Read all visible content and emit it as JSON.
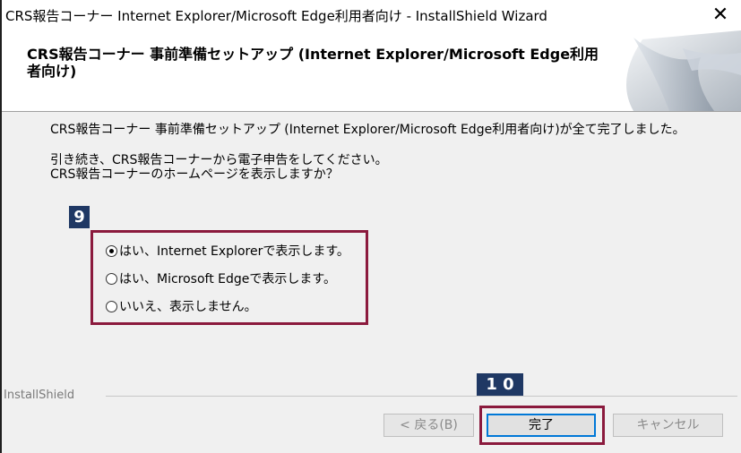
{
  "window": {
    "title": "CRS報告コーナー Internet Explorer/Microsoft Edge利用者向け - InstallShield Wizard",
    "close_glyph": "✕"
  },
  "header": {
    "title": "CRS報告コーナー 事前準備セットアップ (Internet Explorer/Microsoft Edge利用者向け)"
  },
  "body": {
    "complete_message": "CRS報告コーナー 事前準備セットアップ (Internet Explorer/Microsoft Edge利用者向け)が全て完了しました。",
    "prompt_line1": "引き続き、CRS報告コーナーから電子申告をしてください。",
    "prompt_line2": "CRS報告コーナーのホームページを表示しますか？"
  },
  "annotations": {
    "step9": "9",
    "step10": "1 0",
    "highlight_color": "#8b1a3d",
    "badge_color": "#1f3864"
  },
  "options": [
    {
      "label": "はい、Internet Explorerで表示します。",
      "selected": true
    },
    {
      "label": "はい、Microsoft Edgeで表示します。",
      "selected": false
    },
    {
      "label": "いいえ、表示しません。",
      "selected": false
    }
  ],
  "footer": {
    "brand": "InstallShield",
    "back_label": "< 戻る(B)",
    "finish_label": "完了",
    "cancel_label": "キャンセル"
  }
}
